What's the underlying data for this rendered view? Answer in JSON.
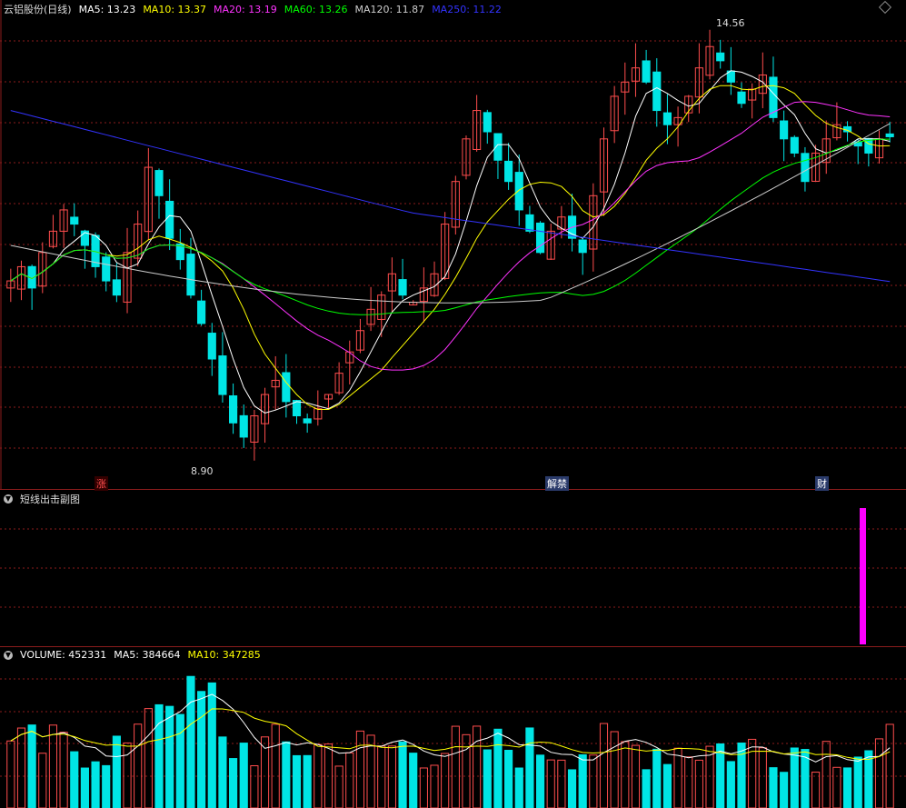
{
  "main": {
    "stock_title": "云铝股份(日线)",
    "ma": [
      {
        "label": "MA5: 13.23",
        "color": "#ffffff"
      },
      {
        "label": "MA10: 13.37",
        "color": "#ffff00"
      },
      {
        "label": "MA20: 13.19",
        "color": "#ff33ff"
      },
      {
        "label": "MA60: 13.26",
        "color": "#00ff00"
      },
      {
        "label": "MA120: 11.87",
        "color": "#cccccc"
      },
      {
        "label": "MA250: 11.22",
        "color": "#3333ff"
      }
    ],
    "high_label": "14.56",
    "low_label": "8.90",
    "markers": [
      "涨",
      "解禁",
      "财"
    ]
  },
  "sub": {
    "title": "短线出击副图"
  },
  "volume": {
    "items": [
      {
        "label": "VOLUME: 452331",
        "color": "#ffffff"
      },
      {
        "label": "MA5: 384664",
        "color": "#ffffff"
      },
      {
        "label": "MA10: 347285",
        "color": "#ffff00"
      }
    ]
  },
  "colors": {
    "up": "#ff4d4d",
    "down": "#00e5e5",
    "grid": "#8b1c1c",
    "signal": "#ff00ff"
  },
  "chart_data": {
    "type": "candlestick",
    "price_range": [
      8.5,
      14.9
    ],
    "closes": [
      11.2,
      11.4,
      11.1,
      11.6,
      11.9,
      12.2,
      12.0,
      11.7,
      11.4,
      11.2,
      11.0,
      11.6,
      12.0,
      12.8,
      12.4,
      11.8,
      11.5,
      11.0,
      10.6,
      10.1,
      9.6,
      9.2,
      9.0,
      9.3,
      9.6,
      9.8,
      9.5,
      9.3,
      9.2,
      9.4,
      9.6,
      9.9,
      10.2,
      10.5,
      10.8,
      11.0,
      11.3,
      11.0,
      10.9,
      11.1,
      11.3,
      12.0,
      12.6,
      13.2,
      13.6,
      13.3,
      12.9,
      12.6,
      12.2,
      11.9,
      11.6,
      11.9,
      12.1,
      11.8,
      11.6,
      12.4,
      13.2,
      13.8,
      14.0,
      14.2,
      14.0,
      13.6,
      13.4,
      13.5,
      13.8,
      14.2,
      14.5,
      14.3,
      14.0,
      13.7,
      13.9,
      14.1,
      13.5,
      13.2,
      13.0,
      12.6,
      13.0,
      13.2,
      13.4,
      13.3,
      13.1,
      13.0,
      13.2,
      13.23
    ],
    "volume_max": 1200000
  }
}
